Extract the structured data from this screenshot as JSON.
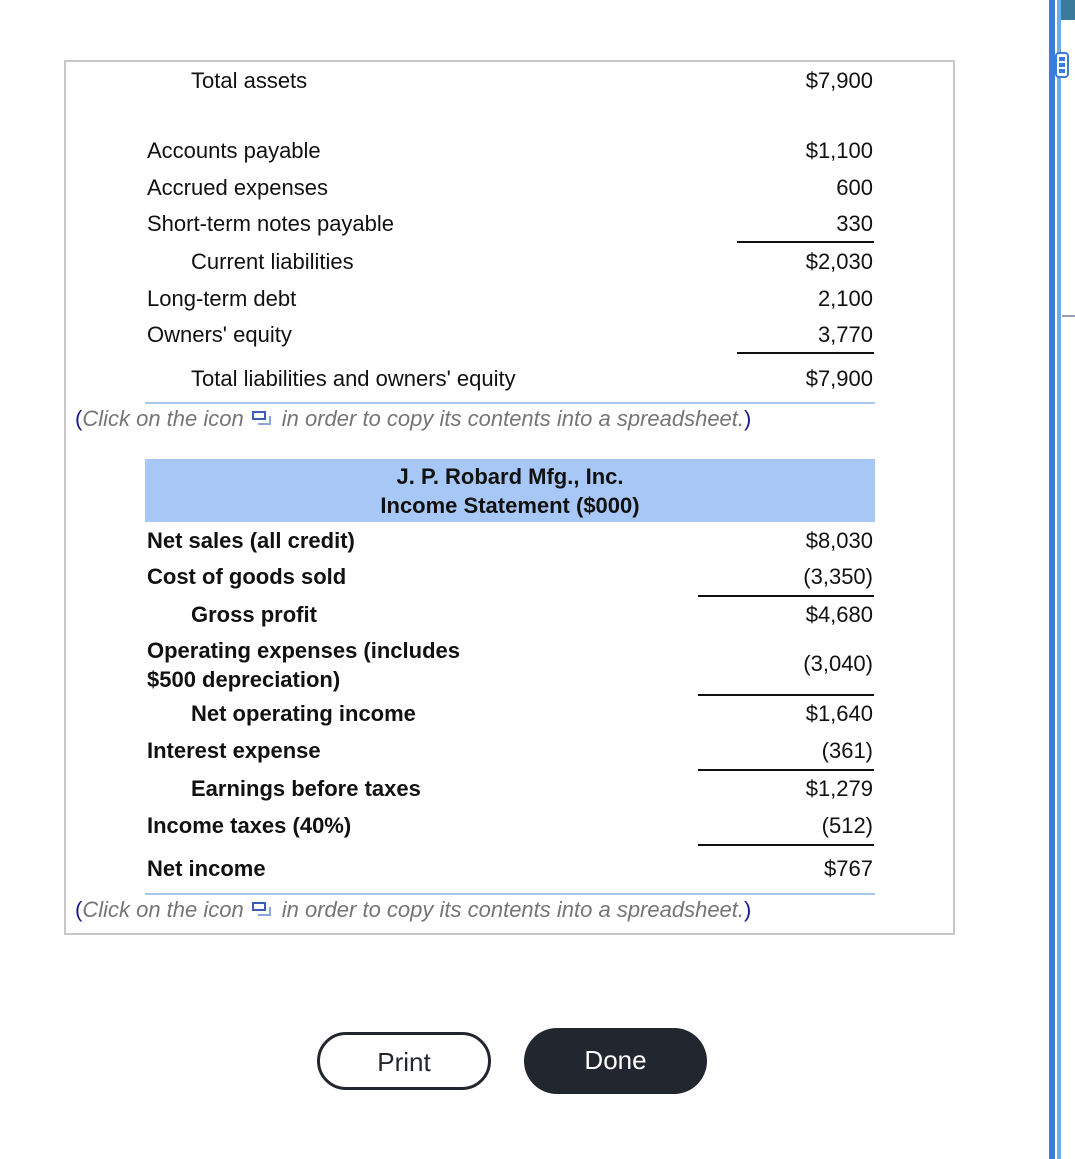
{
  "balance_sheet_tail": {
    "rows": [
      {
        "label": "Total assets",
        "value": "$7,900",
        "indent": true
      },
      {
        "label": "Accounts payable",
        "value": "$1,100"
      },
      {
        "label": "Accrued expenses",
        "value": "600"
      },
      {
        "label": "Short-term notes payable",
        "value": "330"
      },
      {
        "label": "Current liabilities",
        "value": "$2,030",
        "indent": true
      },
      {
        "label": "Long-term debt",
        "value": "2,100"
      },
      {
        "label": "Owners' equity",
        "value": "3,770"
      },
      {
        "label": "Total liabilities and owners' equity",
        "value": "$7,900",
        "indent": true
      }
    ],
    "note": {
      "open": "(",
      "before": "Click on the icon",
      "after": "in order to copy its contents into a spreadsheet.",
      "close": ")"
    }
  },
  "income_statement": {
    "company": "J. P. Robard Mfg., Inc.",
    "title": "Income Statement ($000)",
    "rows": [
      {
        "label": "Net sales (all credit)",
        "value": "$8,030"
      },
      {
        "label": "Cost of goods sold",
        "value": "(3,350)"
      },
      {
        "label": "Gross profit",
        "value": "$4,680",
        "indent": true
      },
      {
        "label": "Operating expenses (includes",
        "label2": "$500 depreciation)",
        "value": "(3,040)"
      },
      {
        "label": "Net operating income",
        "value": "$1,640",
        "indent": true
      },
      {
        "label": "Interest expense",
        "value": "(361)"
      },
      {
        "label": "Earnings before taxes",
        "value": "$1,279",
        "indent": true
      },
      {
        "label": "Income taxes (40%)",
        "value": "(512)"
      },
      {
        "label": "Net income",
        "value": "$767"
      }
    ],
    "note": {
      "open": "(",
      "before": "Click on the icon",
      "after": "in order to copy its contents into a spreadsheet.",
      "close": ")"
    }
  },
  "icons": {
    "copy": "copy-to-spreadsheet-icon"
  },
  "buttons": {
    "print": "Print",
    "done": "Done"
  },
  "colors": {
    "header_band": "#a7c8f6",
    "done_bg": "#22262f",
    "note_text": "#757575",
    "note_paren": "#1a1a8c"
  }
}
